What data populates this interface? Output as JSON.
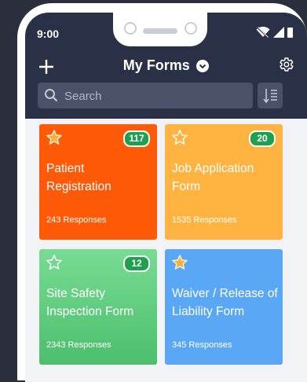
{
  "status": {
    "time": "9:00"
  },
  "header": {
    "title": "My Forms"
  },
  "search": {
    "placeholder": "Search"
  },
  "colors": {
    "topbar": "#2a3046",
    "orange": "#ff5a08",
    "amber": "#ffb340",
    "green": "#52c577",
    "blue": "#5aa8f5",
    "badge": "#1ea14f",
    "star_gold": "#f5b335"
  },
  "forms": [
    {
      "name": "Patient Registration",
      "responses": "243 Responses",
      "count": "117",
      "starred": true
    },
    {
      "name": "Job Application Form",
      "responses": "1535 Responses",
      "count": "20",
      "starred": false
    },
    {
      "name": "Site Safety Inspection Form",
      "responses": "2343 Responses",
      "count": "12",
      "starred": false
    },
    {
      "name": "Waiver / Release of Liability Form",
      "responses": "345 Responses",
      "count": "",
      "starred": true
    }
  ]
}
